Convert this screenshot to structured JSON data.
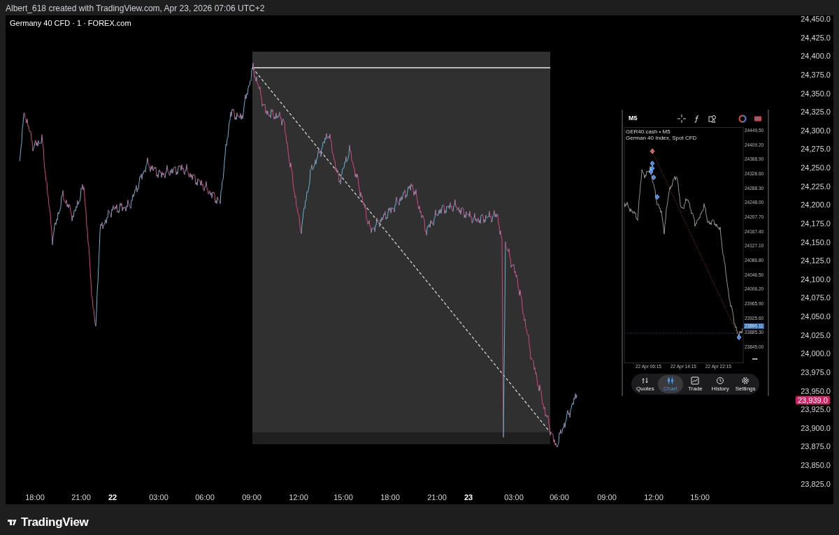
{
  "caption": "Albert_618 created with TradingView.com, Apr 23, 2026 07:06 UTC+2",
  "chart": {
    "title": "Germany 40 CFD · 1 · FOREX.com",
    "price_axis": [
      "24,450.0",
      "24,425.0",
      "24,400.0",
      "24,375.0",
      "24,350.0",
      "24,325.0",
      "24,300.0",
      "24,275.0",
      "24,250.0",
      "24,225.0",
      "24,200.0",
      "24,175.0",
      "24,150.0",
      "24,125.0",
      "24,100.0",
      "24,075.0",
      "24,050.0",
      "24,025.0",
      "24,000.0",
      "23,975.0",
      "23,950.0",
      "23,925.0",
      "23,900.0",
      "23,875.0",
      "23,850.0",
      "23,825.0"
    ],
    "last_price": {
      "label": "23,939.0",
      "color": "#d41f63"
    },
    "time_axis": [
      {
        "label": "18:00",
        "kind": "time"
      },
      {
        "label": "21:00",
        "kind": "time"
      },
      {
        "label": "22",
        "kind": "day"
      },
      {
        "label": "03:00",
        "kind": "time"
      },
      {
        "label": "06:00",
        "kind": "time"
      },
      {
        "label": "09:00",
        "kind": "time"
      },
      {
        "label": "12:00",
        "kind": "time"
      },
      {
        "label": "15:00",
        "kind": "time"
      },
      {
        "label": "18:00",
        "kind": "time"
      },
      {
        "label": "21:00",
        "kind": "time"
      },
      {
        "label": "23",
        "kind": "day"
      },
      {
        "label": "03:00",
        "kind": "time"
      },
      {
        "label": "06:00",
        "kind": "time"
      },
      {
        "label": "09:00",
        "kind": "time"
      },
      {
        "label": "12:00",
        "kind": "time"
      },
      {
        "label": "15:00",
        "kind": "time"
      }
    ]
  },
  "inset": {
    "timeframe": "M5",
    "symbol": "GER40.cash • M5",
    "description": "German 40 Index, Spot CFD",
    "price_axis": [
      "24449.50",
      "24409.20",
      "24368.90",
      "24328.60",
      "24288.30",
      "24248.00",
      "24207.70",
      "24167.40",
      "24127.10",
      "24086.80",
      "24046.50",
      "24006.20",
      "23965.90",
      "23925.60",
      "23885.30",
      "23845.00"
    ],
    "current_price": "23890.11",
    "more": "•••",
    "time_axis": [
      "22 Apr 06:15",
      "22 Apr 14:15",
      "22 Apr 22:15"
    ],
    "nav": [
      {
        "label": "Quotes",
        "kind": "quotes",
        "selected": false
      },
      {
        "label": "Chart",
        "kind": "chart",
        "selected": true
      },
      {
        "label": "Trade",
        "kind": "trade",
        "selected": false
      },
      {
        "label": "History",
        "kind": "history",
        "selected": false
      },
      {
        "label": "Settings",
        "kind": "settings",
        "selected": false
      }
    ]
  },
  "brand": "TradingView"
}
